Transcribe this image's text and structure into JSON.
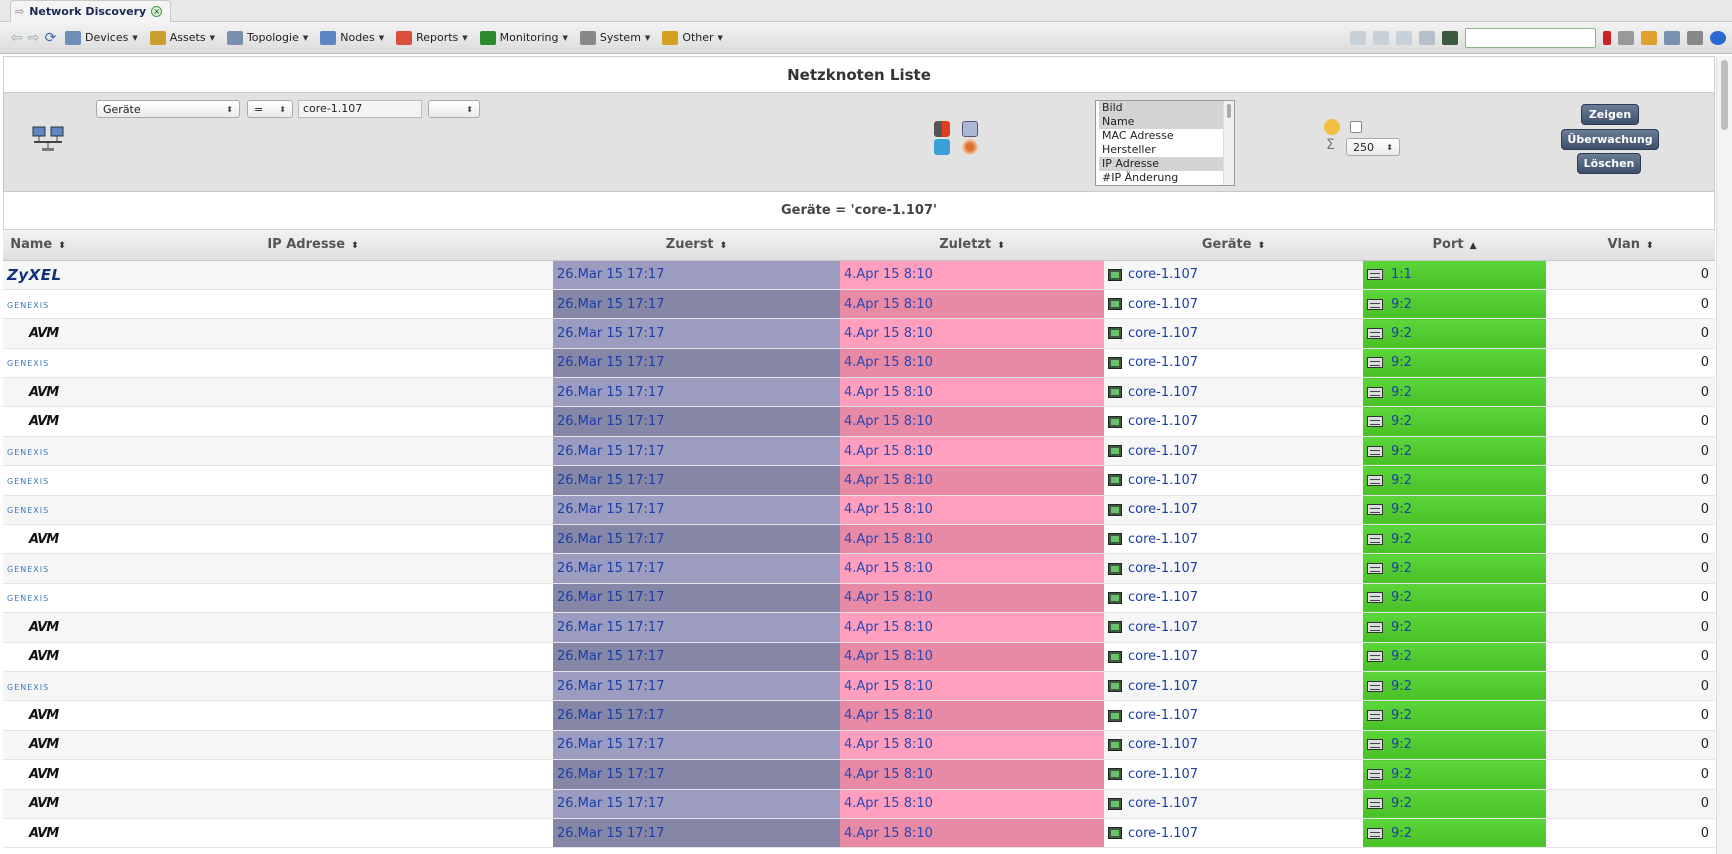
{
  "tab": {
    "title": "Network Discovery"
  },
  "menu": {
    "items": [
      {
        "label": "Devices",
        "icon": "devices-icon",
        "color": "#6d8fb8"
      },
      {
        "label": "Assets",
        "icon": "assets-icon",
        "color": "#c9a030"
      },
      {
        "label": "Topologie",
        "icon": "topology-icon",
        "color": "#7a8fb0"
      },
      {
        "label": "Nodes",
        "icon": "nodes-icon",
        "color": "#5d86c2"
      },
      {
        "label": "Reports",
        "icon": "reports-icon",
        "color": "#d8503a"
      },
      {
        "label": "Monitoring",
        "icon": "monitoring-icon",
        "color": "#2b8a2b"
      },
      {
        "label": "System",
        "icon": "gear-icon",
        "color": "#888888"
      },
      {
        "label": "Other",
        "icon": "other-icon",
        "color": "#d4a020"
      }
    ],
    "search_value": ""
  },
  "page": {
    "title": "Netzknoten Liste",
    "condition": "Geräte = 'core-1.107'"
  },
  "filter": {
    "field": "Geräte",
    "operator": "=",
    "value": "core-1.107",
    "extra": "",
    "columns": [
      "Bild",
      "Name",
      "MAC Adresse",
      "Hersteller",
      "IP Adresse",
      "#IP Änderung"
    ],
    "selected_columns": [
      "Bild",
      "Name",
      "IP Adresse"
    ],
    "limit": "250",
    "buttons": {
      "show": "Zeigen",
      "monitor": "Überwachung",
      "delete": "Löschen"
    }
  },
  "table": {
    "headers": [
      "Name",
      "IP Adresse",
      "Zuerst",
      "Zuletzt",
      "Geräte",
      "Port",
      "Vlan"
    ],
    "sorted_column": "Port",
    "colors": {
      "zuerst_light": "#9c9cc0",
      "zuerst_dark": "#8686a6",
      "zuletzt_light": "#ff9fbd",
      "zuletzt_dark": "#e889a6",
      "port": "#5cd63a"
    },
    "rows": [
      {
        "logo": "ZyXEL",
        "ip": "",
        "first": "26.Mar 15 17:17",
        "last": "4.Apr 15 8:10",
        "device": "core-1.107",
        "port": "1:1",
        "vlan": "0"
      },
      {
        "logo": "GENEXIS",
        "ip": "",
        "first": "26.Mar 15 17:17",
        "last": "4.Apr 15 8:10",
        "device": "core-1.107",
        "port": "9:2",
        "vlan": "0"
      },
      {
        "logo": "AVM",
        "ip": "",
        "first": "26.Mar 15 17:17",
        "last": "4.Apr 15 8:10",
        "device": "core-1.107",
        "port": "9:2",
        "vlan": "0"
      },
      {
        "logo": "GENEXIS",
        "ip": "",
        "first": "26.Mar 15 17:17",
        "last": "4.Apr 15 8:10",
        "device": "core-1.107",
        "port": "9:2",
        "vlan": "0"
      },
      {
        "logo": "AVM",
        "ip": "",
        "first": "26.Mar 15 17:17",
        "last": "4.Apr 15 8:10",
        "device": "core-1.107",
        "port": "9:2",
        "vlan": "0"
      },
      {
        "logo": "AVM",
        "ip": "",
        "first": "26.Mar 15 17:17",
        "last": "4.Apr 15 8:10",
        "device": "core-1.107",
        "port": "9:2",
        "vlan": "0"
      },
      {
        "logo": "GENEXIS",
        "ip": "",
        "first": "26.Mar 15 17:17",
        "last": "4.Apr 15 8:10",
        "device": "core-1.107",
        "port": "9:2",
        "vlan": "0"
      },
      {
        "logo": "GENEXIS",
        "ip": "",
        "first": "26.Mar 15 17:17",
        "last": "4.Apr 15 8:10",
        "device": "core-1.107",
        "port": "9:2",
        "vlan": "0"
      },
      {
        "logo": "GENEXIS",
        "ip": "",
        "first": "26.Mar 15 17:17",
        "last": "4.Apr 15 8:10",
        "device": "core-1.107",
        "port": "9:2",
        "vlan": "0"
      },
      {
        "logo": "AVM",
        "ip": "",
        "first": "26.Mar 15 17:17",
        "last": "4.Apr 15 8:10",
        "device": "core-1.107",
        "port": "9:2",
        "vlan": "0"
      },
      {
        "logo": "GENEXIS",
        "ip": "",
        "first": "26.Mar 15 17:17",
        "last": "4.Apr 15 8:10",
        "device": "core-1.107",
        "port": "9:2",
        "vlan": "0"
      },
      {
        "logo": "GENEXIS",
        "ip": "",
        "first": "26.Mar 15 17:17",
        "last": "4.Apr 15 8:10",
        "device": "core-1.107",
        "port": "9:2",
        "vlan": "0"
      },
      {
        "logo": "AVM",
        "ip": "",
        "first": "26.Mar 15 17:17",
        "last": "4.Apr 15 8:10",
        "device": "core-1.107",
        "port": "9:2",
        "vlan": "0"
      },
      {
        "logo": "AVM",
        "ip": "",
        "first": "26.Mar 15 17:17",
        "last": "4.Apr 15 8:10",
        "device": "core-1.107",
        "port": "9:2",
        "vlan": "0"
      },
      {
        "logo": "GENEXIS",
        "ip": "",
        "first": "26.Mar 15 17:17",
        "last": "4.Apr 15 8:10",
        "device": "core-1.107",
        "port": "9:2",
        "vlan": "0"
      },
      {
        "logo": "AVM",
        "ip": "",
        "first": "26.Mar 15 17:17",
        "last": "4.Apr 15 8:10",
        "device": "core-1.107",
        "port": "9:2",
        "vlan": "0"
      },
      {
        "logo": "AVM",
        "ip": "",
        "first": "26.Mar 15 17:17",
        "last": "4.Apr 15 8:10",
        "device": "core-1.107",
        "port": "9:2",
        "vlan": "0"
      },
      {
        "logo": "AVM",
        "ip": "",
        "first": "26.Mar 15 17:17",
        "last": "4.Apr 15 8:10",
        "device": "core-1.107",
        "port": "9:2",
        "vlan": "0"
      },
      {
        "logo": "AVM",
        "ip": "",
        "first": "26.Mar 15 17:17",
        "last": "4.Apr 15 8:10",
        "device": "core-1.107",
        "port": "9:2",
        "vlan": "0"
      },
      {
        "logo": "AVM",
        "ip": "",
        "first": "26.Mar 15 17:17",
        "last": "4.Apr 15 8:10",
        "device": "core-1.107",
        "port": "9:2",
        "vlan": "0"
      }
    ]
  }
}
